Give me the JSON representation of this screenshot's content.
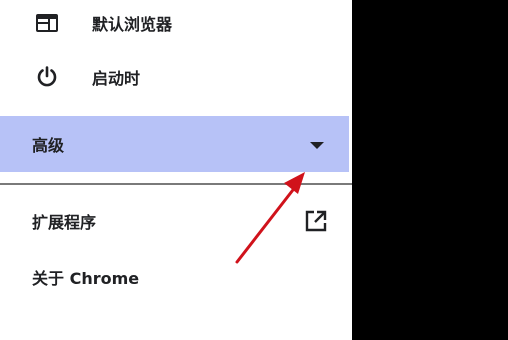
{
  "menu": {
    "default_browser": {
      "label": "默认浏览器",
      "icon": "browser-window-icon"
    },
    "on_startup": {
      "label": "启动时",
      "icon": "power-icon"
    },
    "advanced": {
      "label": "高级",
      "icon": "caret-down-icon"
    },
    "extensions": {
      "label": "扩展程序",
      "icon": "open-in-new-icon"
    },
    "about": {
      "label": "关于 Chrome"
    }
  },
  "colors": {
    "advanced_highlight": "#b7c2f7",
    "annotation_arrow": "#d0121b",
    "text": "#202124",
    "right_panel": "#000000"
  }
}
